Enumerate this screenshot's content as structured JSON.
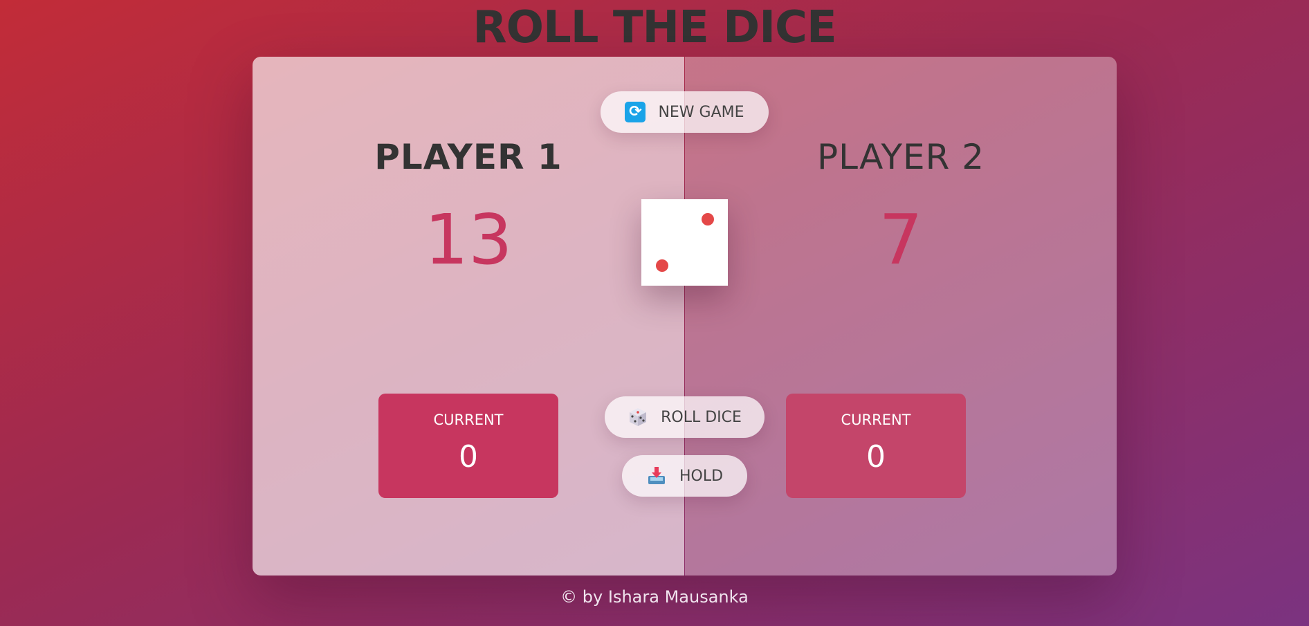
{
  "title": "ROLL THE DICE",
  "players": [
    {
      "name": "PLAYER 1",
      "score": "13",
      "current_label": "CURRENT",
      "current_score": "0",
      "active": true
    },
    {
      "name": "PLAYER 2",
      "score": "7",
      "current_label": "CURRENT",
      "current_score": "0",
      "active": false
    }
  ],
  "buttons": {
    "new_game": "NEW GAME",
    "roll_dice": "ROLL DICE",
    "hold": "HOLD"
  },
  "icons": {
    "new_game": "refresh-icon",
    "roll_dice": "dice-icon",
    "hold": "hold-inbox-icon"
  },
  "dice": {
    "value": 2
  },
  "footer": "© by Ishara Mausanka",
  "colors": {
    "accent": "#c7365f",
    "pip": "#e44848",
    "refresh_icon": "#1aa3e8"
  }
}
